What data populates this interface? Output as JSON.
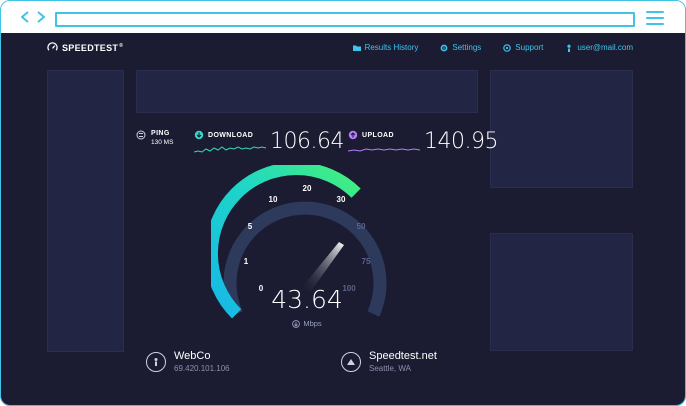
{
  "browser": {
    "back_icon": "chevron-left-icon",
    "forward_icon": "chevron-right-icon",
    "menu_icon": "hamburger-icon",
    "accent": "#41c3e6"
  },
  "app": {
    "logo_text": "SPEEDTEST",
    "logo_mark": "®",
    "nav": [
      {
        "label": "Results History",
        "icon": "folder-icon"
      },
      {
        "label": "Settings",
        "icon": "gear-icon"
      },
      {
        "label": "Support",
        "icon": "help-icon"
      },
      {
        "label": "user@mail.com",
        "icon": "user-icon"
      }
    ]
  },
  "metrics": {
    "ping": {
      "label": "PING",
      "value": "130 MS"
    },
    "download": {
      "label": "DOWNLOAD",
      "value": "106.64",
      "color": "#36d8c1"
    },
    "upload": {
      "label": "UPLOAD",
      "value": "140.95",
      "color": "#b77cff"
    }
  },
  "gauge": {
    "current": "43.64",
    "unit": "Mbps",
    "ticks": [
      "0",
      "1",
      "5",
      "10",
      "20",
      "30",
      "50",
      "75",
      "100"
    ],
    "needle_value": 30,
    "colors": {
      "start": "#16b7e8",
      "end": "#45f07a",
      "track": "#2e3a5c"
    }
  },
  "servers": {
    "isp": {
      "name": "WebCo",
      "detail": "69.420.101.106",
      "icon": "person-icon"
    },
    "host": {
      "name": "Speedtest.net",
      "detail": "Seattle, WA",
      "icon": "triangle-icon"
    }
  }
}
